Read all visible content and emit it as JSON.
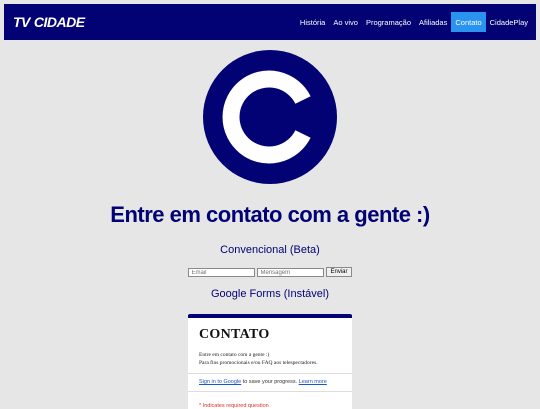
{
  "nav": {
    "brand_prefix": "TV",
    "brand_name": "CIDADE",
    "items": [
      {
        "label": "História",
        "active": false
      },
      {
        "label": "Ao vivo",
        "active": false
      },
      {
        "label": "Programação",
        "active": false
      },
      {
        "label": "Afiliadas",
        "active": false
      },
      {
        "label": "Contato",
        "active": true
      },
      {
        "label": "CidadePlay",
        "active": false
      }
    ]
  },
  "logo_icon": "letter-c-circle-logo",
  "colors": {
    "navy": "#020275",
    "accent": "#2a93ef",
    "background": "#e6e6e6"
  },
  "main": {
    "headline": "Entre em contato com a gente :)",
    "conventional_heading": "Convencional (Beta)",
    "email_placeholder": "Email",
    "message_placeholder": "Mensagem",
    "send_label": "Enviar",
    "forms_heading": "Google Forms (Instável)"
  },
  "gform": {
    "title": "CONTATO",
    "desc_line1": "Entre em contato com a gente :)",
    "desc_line2": "Para fins promocionais e/ou FAQ aos telespectadores.",
    "signin_link": "Sign in to Google",
    "signin_text": " to save your progress. ",
    "learn_more": "Learn more",
    "required_note": "* Indicates required question"
  }
}
